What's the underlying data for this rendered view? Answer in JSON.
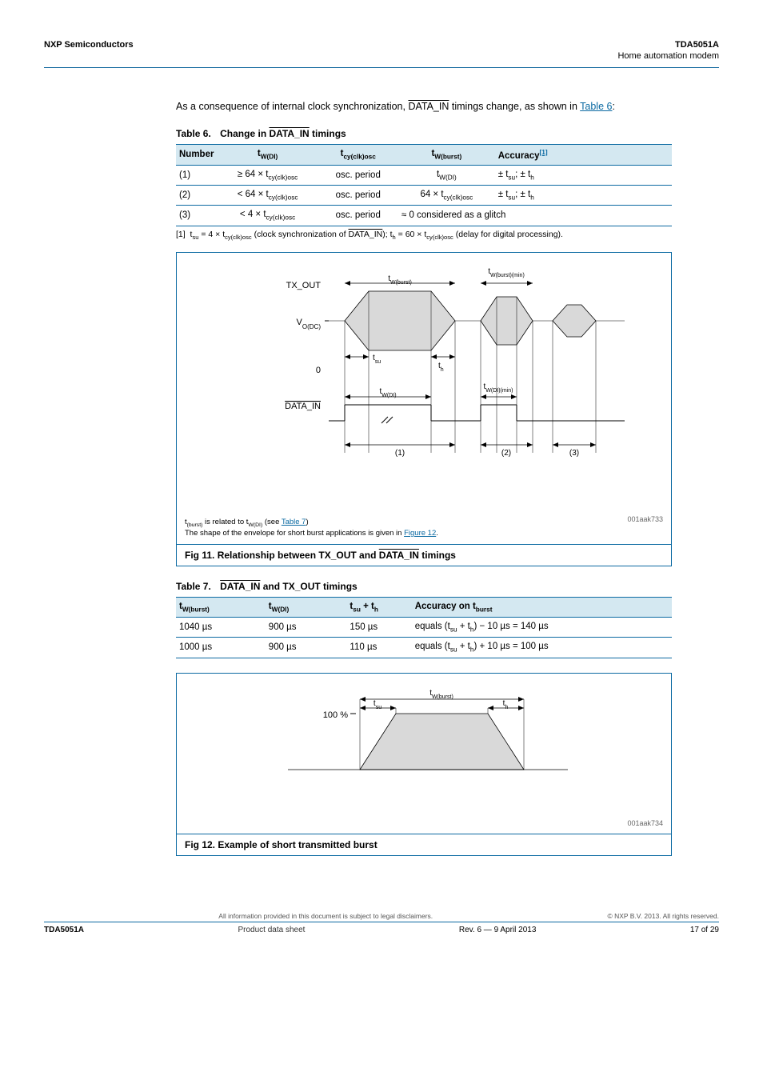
{
  "header": {
    "company": "NXP Semiconductors",
    "doc_id": "TDA5051A",
    "doc_title": "Home automation modem"
  },
  "intro_para": "As a consequence of internal clock synchronization, DATA_IN timings change, as shown in Table 6:",
  "table6": {
    "caption_label": "Table 6.",
    "caption_text": "Change in DATA_IN timings",
    "headers": [
      "Number",
      "tW(DI)",
      "tcy(clk)osc",
      "tW(burst)",
      "Accuracy[1]"
    ],
    "rows": [
      [
        "(1)",
        "≥ 64 × tcy(clk)osc",
        "osc. period",
        "tW(DI)",
        "± tsu; ± th"
      ],
      [
        "(2)",
        "< 64 × tcy(clk)osc",
        "osc. period",
        "64 × tcy(clk)osc",
        "± tsu; ± th"
      ],
      [
        "(3)",
        "< 4 × tcy(clk)osc",
        "osc. period",
        "≈ 0 considered as a glitch",
        ""
      ]
    ],
    "footnote": "[1]  tsu = 4 × tcy(clk)osc (clock synchronization of DATA_IN); th = 60 × tcy(clk)osc (delay for digital processing)."
  },
  "figure11": {
    "labels": {
      "tx_out": "TX_OUT",
      "vodc": "VO(DC)",
      "zero": "0",
      "data_in": "DATA_IN",
      "twburst": "tW(burst)",
      "twburstmin": "tW(burst)(min)",
      "tsu": "tsu",
      "th": "th",
      "twdi": "tW(DI)",
      "twdimin": "tW(DI)(min)",
      "m1": "(1)",
      "m2": "(2)",
      "m3": "(3)"
    },
    "idtag": "001aak733",
    "footnote_prefix": "t(burst) is related to tW(DI) (see ",
    "footnote_link1": "Table 7",
    "footnote_mid": ") The shape of the envelope for short burst applications is given in ",
    "footnote_link2": "Figure 12",
    "footnote_end": ".",
    "caption_label": "Fig 11.",
    "caption_text_prefix": "Relationship between TX_OUT and ",
    "caption_text_datain": "DATA_IN",
    "caption_text_suffix": " timings"
  },
  "table7": {
    "caption_label": "Table 7.",
    "caption_text": "DATA_IN and TX_OUT timings",
    "headers": [
      "tW(burst)",
      "tW(DI)",
      "tsu + th",
      "Accuracy on tburst"
    ],
    "rows": [
      [
        "1040 µs",
        "900 µs",
        "150 µs",
        "equals (tsu + th) − 10 µs = 140 µs"
      ],
      [
        "1000 µs",
        "900 µs",
        "110 µs",
        "equals (tsu + th) + 10 µs = 100 µs"
      ]
    ]
  },
  "figure12": {
    "labels": {
      "100pct": "100 %",
      "twburst": "tW(burst)",
      "tsu": "tsu",
      "th": "th"
    },
    "idtag": "001aak734",
    "caption_label": "Fig 12.",
    "caption_text": "Example of short transmitted burst"
  },
  "footer": {
    "left": "TDA5051A",
    "mid_line1": "All information provided in this document is subject to legal disclaimers.",
    "mid_line2_left": "Product data sheet",
    "mid_line2_mid": "Rev. 6 — 9 April 2013",
    "right_line1": "© NXP B.V. 2013. All rights reserved.",
    "right_line2": "17 of 29"
  }
}
